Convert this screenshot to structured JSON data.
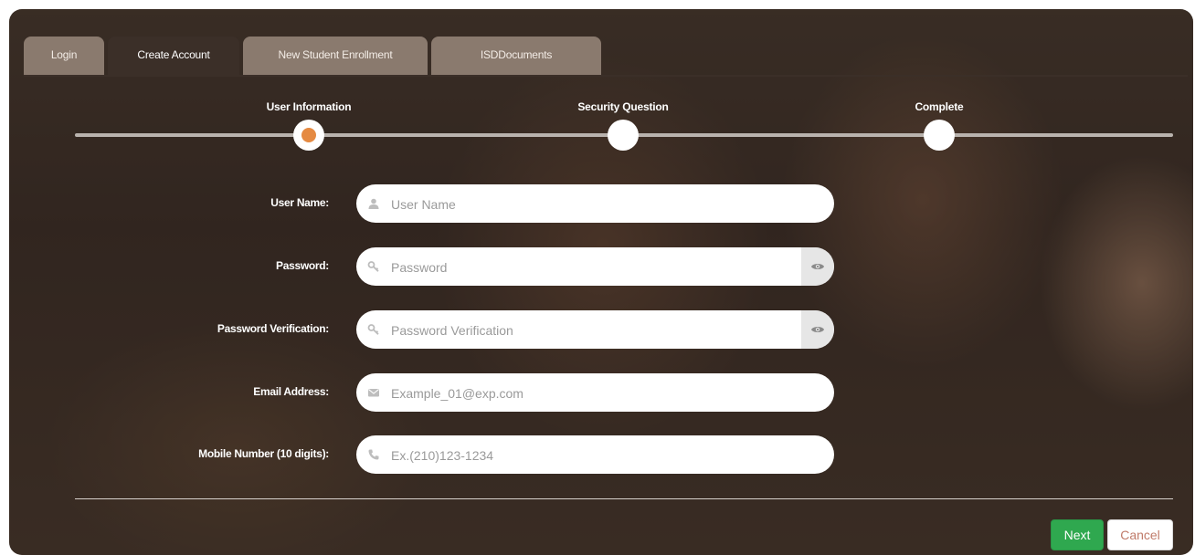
{
  "tabs": [
    {
      "label": "Login",
      "active": false
    },
    {
      "label": "Create Account",
      "active": true
    },
    {
      "label": "New Student Enrollment",
      "active": false
    },
    {
      "label": "ISDDocuments",
      "active": false
    }
  ],
  "steps": [
    {
      "label": "User Information",
      "current": true
    },
    {
      "label": "Security Question",
      "current": false
    },
    {
      "label": "Complete",
      "current": false
    }
  ],
  "form": {
    "username": {
      "label": "User Name:",
      "placeholder": "User Name",
      "value": ""
    },
    "password": {
      "label": "Password:",
      "placeholder": "Password",
      "value": ""
    },
    "password_verification": {
      "label": "Password Verification:",
      "placeholder": "Password Verification",
      "value": ""
    },
    "email": {
      "label": "Email Address:",
      "placeholder": "Example_01@exp.com",
      "value": ""
    },
    "mobile": {
      "label": "Mobile Number (10 digits):",
      "placeholder": "Ex.(210)123-1234",
      "value": ""
    }
  },
  "buttons": {
    "next": "Next",
    "cancel": "Cancel"
  },
  "icons": {
    "username": "user-icon",
    "password": "key-icon",
    "password_verification": "key-icon",
    "email": "envelope-icon",
    "mobile": "phone-icon",
    "toggle": "eye-icon"
  },
  "colors": {
    "accent_step": "#e58a42",
    "next_button": "#2fa84f",
    "active_tab": "#3b2f28",
    "inactive_tab": "#8a7a6e"
  }
}
